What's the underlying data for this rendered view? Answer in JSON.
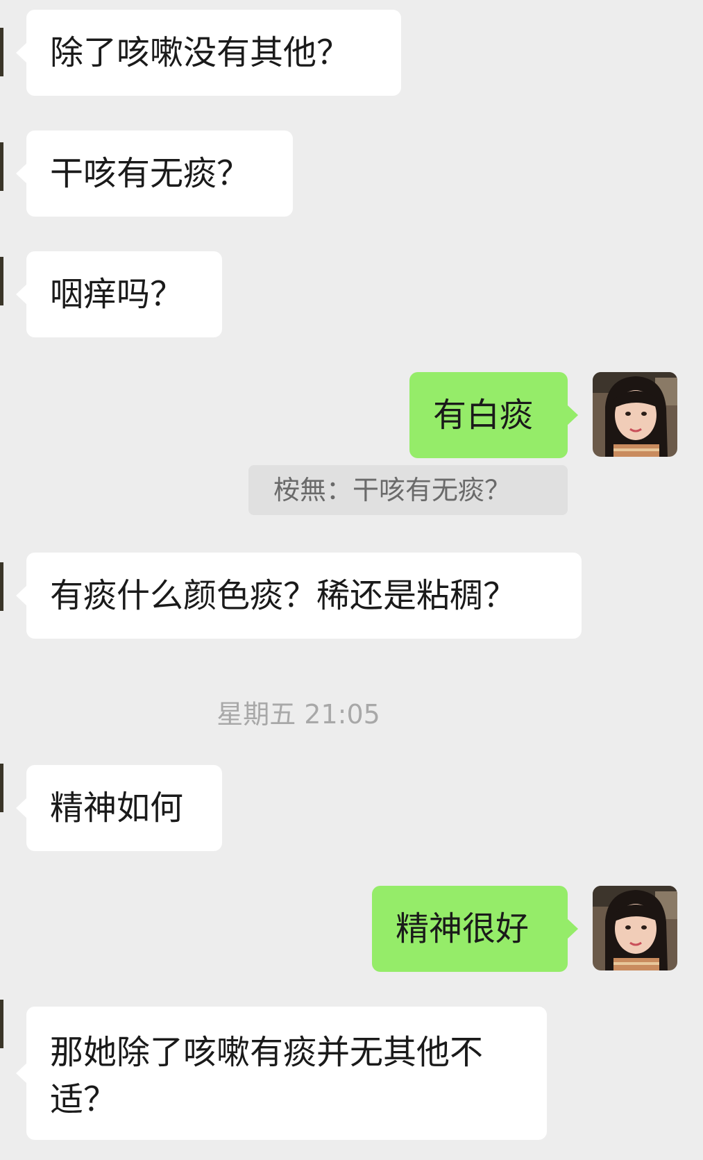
{
  "messages": [
    {
      "sender": "other",
      "text": "除了咳嗽没有其他？"
    },
    {
      "sender": "other",
      "text": "干咳有无痰？"
    },
    {
      "sender": "other",
      "text": "咽痒吗？"
    },
    {
      "sender": "self",
      "text": "有白痰",
      "quote": "桉無：干咳有无痰？"
    },
    {
      "sender": "other",
      "text": "有痰什么颜色痰？稀还是粘稠？"
    },
    {
      "timestamp": "星期五 21:05"
    },
    {
      "sender": "other",
      "text": "精神如何"
    },
    {
      "sender": "self",
      "text": "精神很好"
    },
    {
      "sender": "other",
      "text": "那她除了咳嗽有痰并无其他不适？"
    }
  ],
  "colors": {
    "background": "#ededed",
    "incoming_bubble": "#ffffff",
    "outgoing_bubble": "#95ec69",
    "quote_background": "#e0e0e0",
    "timestamp_text": "#a8a8a8"
  }
}
